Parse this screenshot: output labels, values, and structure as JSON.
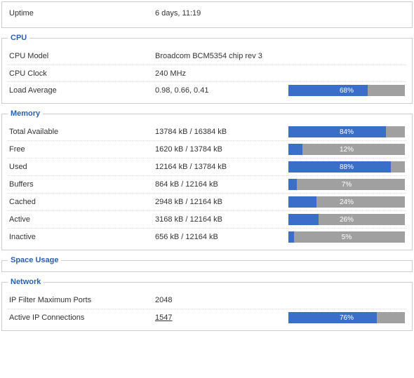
{
  "top": {
    "uptime_label": "Uptime",
    "uptime_value": "6 days, 11:19"
  },
  "cpu": {
    "legend": "CPU",
    "rows": [
      {
        "label": "CPU Model",
        "value": "Broadcom BCM5354 chip rev 3",
        "pct": null
      },
      {
        "label": "CPU Clock",
        "value": "240 MHz",
        "pct": null
      },
      {
        "label": "Load Average",
        "value": "0.98, 0.66, 0.41",
        "pct": 68
      }
    ]
  },
  "memory": {
    "legend": "Memory",
    "rows": [
      {
        "label": "Total Available",
        "value": "13784 kB / 16384 kB",
        "pct": 84
      },
      {
        "label": "Free",
        "value": "1620 kB / 13784 kB",
        "pct": 12
      },
      {
        "label": "Used",
        "value": "12164 kB / 13784 kB",
        "pct": 88
      },
      {
        "label": "Buffers",
        "value": "864 kB / 12164 kB",
        "pct": 7
      },
      {
        "label": "Cached",
        "value": "2948 kB / 12164 kB",
        "pct": 24
      },
      {
        "label": "Active",
        "value": "3168 kB / 12164 kB",
        "pct": 26
      },
      {
        "label": "Inactive",
        "value": "656 kB / 12164 kB",
        "pct": 5
      }
    ]
  },
  "space": {
    "legend": "Space Usage"
  },
  "network": {
    "legend": "Network",
    "rows": [
      {
        "label": "IP Filter Maximum Ports",
        "value": "2048",
        "pct": null,
        "link": false
      },
      {
        "label": "Active IP Connections",
        "value": "1547",
        "pct": 76,
        "link": true
      }
    ]
  },
  "colors": {
    "bar_fill": "#3a6ec8",
    "bar_bg": "#a0a0a0",
    "legend": "#2b5fae"
  }
}
